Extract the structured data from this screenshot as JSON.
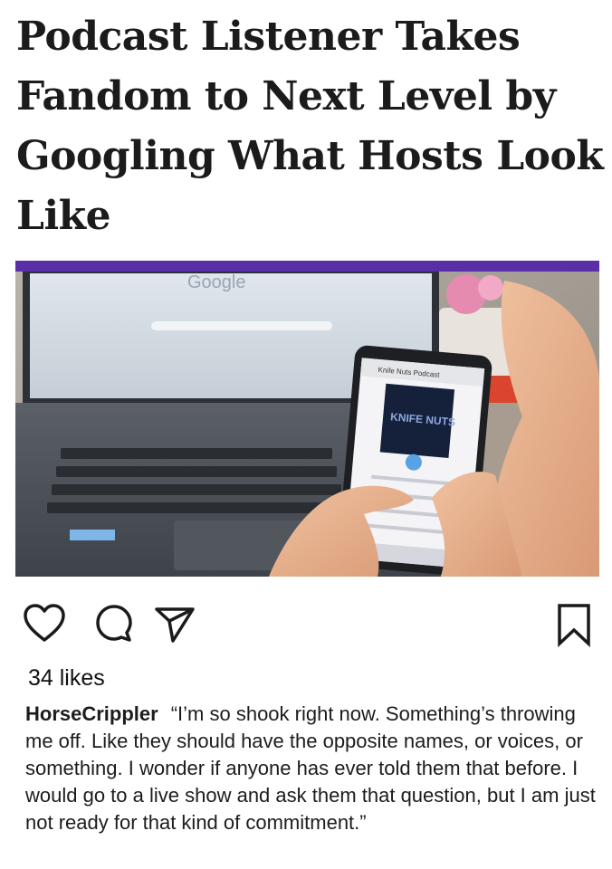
{
  "article": {
    "headline_lines": [
      "Podcast Listener Takes",
      "Fandom to Next Level by",
      "Googling What Hosts Look",
      "Like"
    ]
  },
  "photo": {
    "browser_logo_text": "Google",
    "phone_app_title": "Knife Nuts Podcast",
    "phone_cover_text": "KNIFE NUTS"
  },
  "colors": {
    "accent_bar": "#5a2ea6",
    "text": "#1b1b1b"
  },
  "post": {
    "likes": "34 likes",
    "username": "HorseCrippler",
    "caption": "“I’m so shook right now. Something’s throwing me off. Like they should have the opposite names, or voices, or something. I wonder if anyone has ever told them that before. I would go to a live show and ask them that question, but I am just not ready for that kind of commitment.”"
  },
  "icons": [
    "heart-icon",
    "comment-icon",
    "share-icon",
    "bookmark-icon"
  ]
}
